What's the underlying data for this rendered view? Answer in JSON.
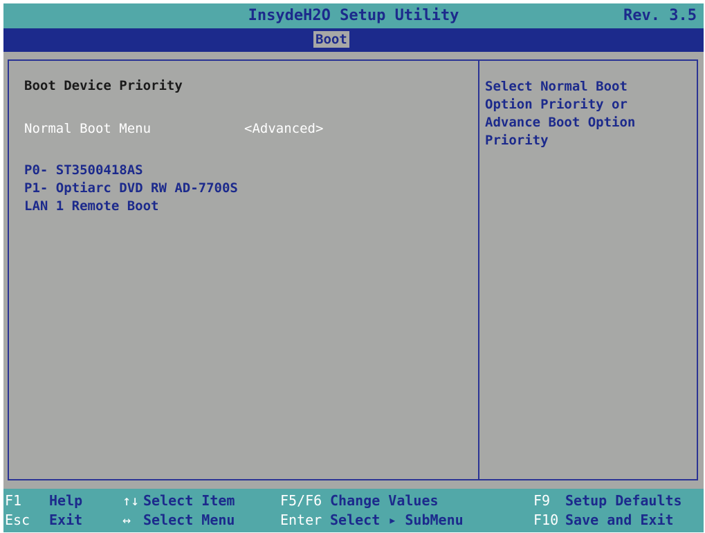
{
  "header": {
    "title": "InsydeH2O Setup Utility",
    "revision": "Rev. 3.5"
  },
  "menu": {
    "active_tab": "Boot"
  },
  "main": {
    "heading": "Boot Device Priority",
    "normal_boot_menu": {
      "label": "Normal Boot Menu",
      "value": "<Advanced>"
    },
    "devices": [
      "P0- ST3500418AS",
      "P1- Optiarc DVD RW AD-7700S",
      "LAN 1 Remote Boot"
    ]
  },
  "help": {
    "text": "Select Normal Boot\nOption Priority or\nAdvance Boot Option\nPriority"
  },
  "keys": {
    "f1": {
      "key": "F1",
      "label": "Help"
    },
    "esc": {
      "key": "Esc",
      "label": "Exit"
    },
    "arrows_ud": {
      "key": "↑↓",
      "label": "Select Item"
    },
    "arrows_lr": {
      "key": "↔",
      "label": "Select Menu"
    },
    "f5f6": {
      "key": "F5/F6",
      "label": "Change Values"
    },
    "enter": {
      "key": "Enter",
      "label": "Select ▸ SubMenu"
    },
    "f9": {
      "key": "F9",
      "label": "Setup Defaults"
    },
    "f10": {
      "key": "F10",
      "label": "Save and Exit"
    }
  },
  "colors": {
    "title_bar": "#52a8a8",
    "menu_bar": "#1c2a8c",
    "background": "#a7a8a6",
    "text_blue": "#1c2a8c",
    "highlight_text": "#ffffff"
  }
}
